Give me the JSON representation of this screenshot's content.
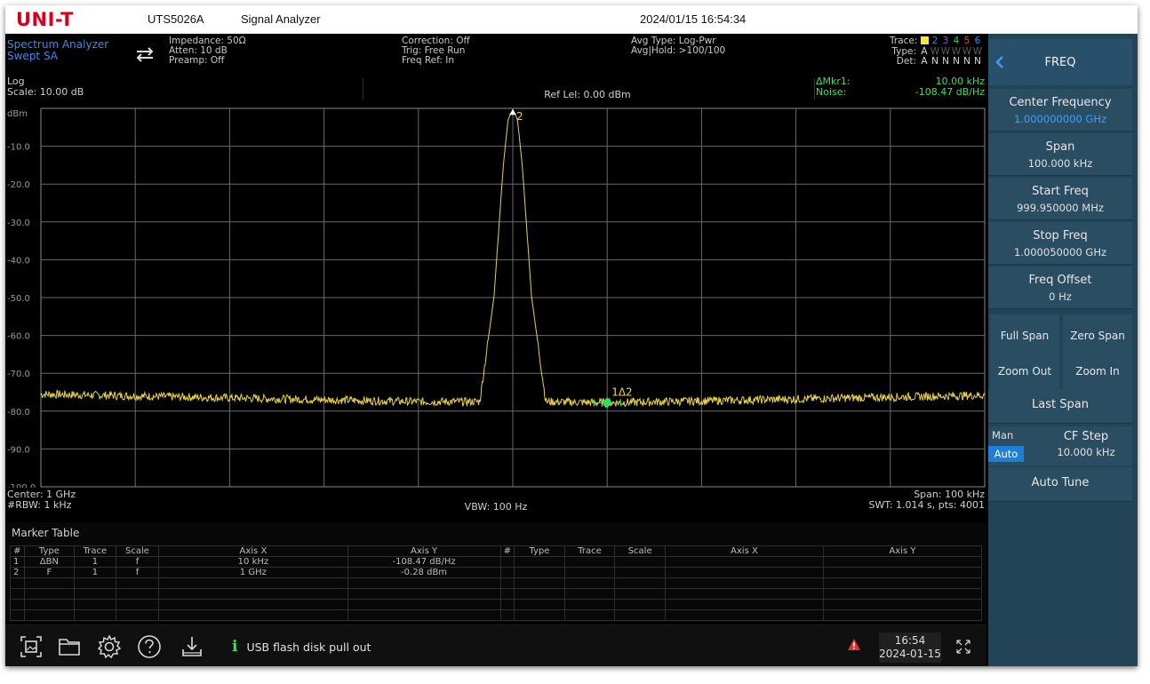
{
  "titlebar": {
    "brand": "UNI-T",
    "model": "UTS5026A",
    "app_title": "Signal Analyzer",
    "datetime": "2024/01/15 16:54:34"
  },
  "status": {
    "mode": [
      "Spectrum Analyzer",
      "Swept SA"
    ],
    "impedance": "Impedance: 50Ω",
    "atten": "Atten: 10 dB",
    "preamp": "Preamp: Off",
    "correction": "Correction: Off",
    "trig": "Trig: Free Run",
    "freq_ref": "Freq Ref: In",
    "avg_type": "Avg Type: Log-Pwr",
    "avg_hold": "Avg|Hold: >100/100",
    "trace_label": "Trace:",
    "type_label": "Type:",
    "det_label": "Det:",
    "trace_numbers": [
      "2",
      "3",
      "4",
      "5",
      "6"
    ],
    "trace_types": [
      "A",
      "W",
      "W",
      "W",
      "W",
      "W"
    ],
    "trace_dets": [
      "A",
      "N",
      "N",
      "N",
      "N",
      "N"
    ],
    "trace_colors": [
      "#ffe14a",
      "#2e8ef0",
      "#a04bd8",
      "#2ecf5a",
      "#e8463c",
      "#2e8ef0"
    ]
  },
  "plot_header": {
    "scale_type": "Log",
    "scale": "Scale: 10.00 dB",
    "ref_level": "Ref Lel: 0.00 dBm",
    "marker_label": "ΔMkr1:",
    "noise_label": "Noise:",
    "marker_freq": "10.00 kHz",
    "marker_value": "-108.47 dB/Hz"
  },
  "chart_data": {
    "type": "line",
    "xlim": [
      999.95,
      1000.05
    ],
    "xunit": "MHz",
    "ylim": [
      -100,
      0
    ],
    "yunit": "dBm",
    "y_ticks": [
      "dBm",
      "-10.0",
      "-20.0",
      "-30.0",
      "-40.0",
      "-50.0",
      "-60.0",
      "-70.0",
      "-80.0",
      "-90.0",
      "-100.0"
    ],
    "grid": true,
    "series": [
      {
        "trace": "1",
        "color": "#e8d24a",
        "x": [
          999.95,
          999.96,
          999.97,
          999.98,
          999.99,
          999.9965,
          999.998,
          999.999,
          999.9995,
          1000.0,
          1000.0005,
          1000.001,
          1000.002,
          1000.0035,
          1000.01,
          1000.02,
          1000.03,
          1000.04,
          1000.05
        ],
        "y": [
          -75.5,
          -76.0,
          -76.5,
          -77.0,
          -77.5,
          -77.5,
          -50.0,
          -15.0,
          -3.0,
          -0.28,
          -3.0,
          -15.0,
          -50.0,
          -77.5,
          -77.8,
          -77.3,
          -76.8,
          -76.3,
          -75.8
        ]
      }
    ],
    "markers": [
      {
        "label": "2",
        "x": 1000.0,
        "y": -0.28
      },
      {
        "label": "1Δ2",
        "x": 1000.01,
        "y": -77.8
      }
    ]
  },
  "plot_footer": {
    "center": "Center: 1 GHz",
    "rbw": "#RBW: 1 kHz",
    "vbw": "VBW: 100 Hz",
    "span": "Span: 100 kHz",
    "swt": "SWT: 1.014 s, pts: 4001"
  },
  "marker_table": {
    "title": "Marker Table",
    "headers": [
      "#",
      "Type",
      "Trace",
      "Scale",
      "Axis X",
      "Axis Y",
      "#",
      "Type",
      "Trace",
      "Scale",
      "Axis X",
      "Axis Y"
    ],
    "rows": [
      [
        "1",
        "ΔBN",
        "1",
        "f",
        "10 kHz",
        "-108.47 dB/Hz",
        "",
        "",
        "",
        "",
        "",
        ""
      ],
      [
        "2",
        "F",
        "1",
        "f",
        "1 GHz",
        "-0.28 dBm",
        "",
        "",
        "",
        "",
        "",
        ""
      ],
      [
        "",
        "",
        "",
        "",
        "",
        "",
        "",
        "",
        "",
        "",
        "",
        ""
      ],
      [
        "",
        "",
        "",
        "",
        "",
        "",
        "",
        "",
        "",
        "",
        "",
        ""
      ],
      [
        "",
        "",
        "",
        "",
        "",
        "",
        "",
        "",
        "",
        "",
        "",
        ""
      ],
      [
        "",
        "",
        "",
        "",
        "",
        "",
        "",
        "",
        "",
        "",
        "",
        ""
      ]
    ]
  },
  "taskbar": {
    "icons": [
      "screenshot-icon",
      "folder-icon",
      "settings-icon",
      "help-icon",
      "download-icon"
    ],
    "message": "USB flash disk pull out",
    "clock_time": "16:54",
    "clock_date": "2024-01-15"
  },
  "panel": {
    "title": "FREQ",
    "center_freq_label": "Center Frequency",
    "center_freq_value": "1.000000000 GHz",
    "span_label": "Span",
    "span_value": "100.000 kHz",
    "start_label": "Start Freq",
    "start_value": "999.950000 MHz",
    "stop_label": "Stop Freq",
    "stop_value": "1.000050000 GHz",
    "offset_label": "Freq Offset",
    "offset_value": "0 Hz",
    "full_span": "Full Span",
    "zero_span": "Zero Span",
    "zoom_out": "Zoom Out",
    "zoom_in": "Zoom In",
    "last_span": "Last Span",
    "cf_man": "Man",
    "cf_auto": "Auto",
    "cf_step_label": "CF Step",
    "cf_step_value": "10.000 kHz",
    "auto_tune": "Auto Tune"
  }
}
